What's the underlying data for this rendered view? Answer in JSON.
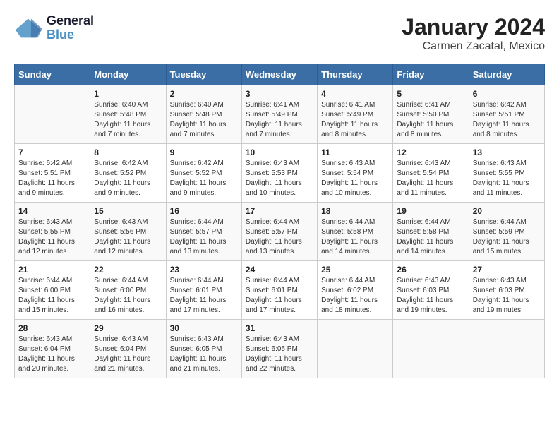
{
  "logo": {
    "line1": "General",
    "line2": "Blue"
  },
  "title": "January 2024",
  "subtitle": "Carmen Zacatal, Mexico",
  "days_of_week": [
    "Sunday",
    "Monday",
    "Tuesday",
    "Wednesday",
    "Thursday",
    "Friday",
    "Saturday"
  ],
  "weeks": [
    [
      {
        "day": "",
        "info": ""
      },
      {
        "day": "1",
        "info": "Sunrise: 6:40 AM\nSunset: 5:48 PM\nDaylight: 11 hours\nand 7 minutes."
      },
      {
        "day": "2",
        "info": "Sunrise: 6:40 AM\nSunset: 5:48 PM\nDaylight: 11 hours\nand 7 minutes."
      },
      {
        "day": "3",
        "info": "Sunrise: 6:41 AM\nSunset: 5:49 PM\nDaylight: 11 hours\nand 7 minutes."
      },
      {
        "day": "4",
        "info": "Sunrise: 6:41 AM\nSunset: 5:49 PM\nDaylight: 11 hours\nand 8 minutes."
      },
      {
        "day": "5",
        "info": "Sunrise: 6:41 AM\nSunset: 5:50 PM\nDaylight: 11 hours\nand 8 minutes."
      },
      {
        "day": "6",
        "info": "Sunrise: 6:42 AM\nSunset: 5:51 PM\nDaylight: 11 hours\nand 8 minutes."
      }
    ],
    [
      {
        "day": "7",
        "info": "Sunrise: 6:42 AM\nSunset: 5:51 PM\nDaylight: 11 hours\nand 9 minutes."
      },
      {
        "day": "8",
        "info": "Sunrise: 6:42 AM\nSunset: 5:52 PM\nDaylight: 11 hours\nand 9 minutes."
      },
      {
        "day": "9",
        "info": "Sunrise: 6:42 AM\nSunset: 5:52 PM\nDaylight: 11 hours\nand 9 minutes."
      },
      {
        "day": "10",
        "info": "Sunrise: 6:43 AM\nSunset: 5:53 PM\nDaylight: 11 hours\nand 10 minutes."
      },
      {
        "day": "11",
        "info": "Sunrise: 6:43 AM\nSunset: 5:54 PM\nDaylight: 11 hours\nand 10 minutes."
      },
      {
        "day": "12",
        "info": "Sunrise: 6:43 AM\nSunset: 5:54 PM\nDaylight: 11 hours\nand 11 minutes."
      },
      {
        "day": "13",
        "info": "Sunrise: 6:43 AM\nSunset: 5:55 PM\nDaylight: 11 hours\nand 11 minutes."
      }
    ],
    [
      {
        "day": "14",
        "info": "Sunrise: 6:43 AM\nSunset: 5:55 PM\nDaylight: 11 hours\nand 12 minutes."
      },
      {
        "day": "15",
        "info": "Sunrise: 6:43 AM\nSunset: 5:56 PM\nDaylight: 11 hours\nand 12 minutes."
      },
      {
        "day": "16",
        "info": "Sunrise: 6:44 AM\nSunset: 5:57 PM\nDaylight: 11 hours\nand 13 minutes."
      },
      {
        "day": "17",
        "info": "Sunrise: 6:44 AM\nSunset: 5:57 PM\nDaylight: 11 hours\nand 13 minutes."
      },
      {
        "day": "18",
        "info": "Sunrise: 6:44 AM\nSunset: 5:58 PM\nDaylight: 11 hours\nand 14 minutes."
      },
      {
        "day": "19",
        "info": "Sunrise: 6:44 AM\nSunset: 5:58 PM\nDaylight: 11 hours\nand 14 minutes."
      },
      {
        "day": "20",
        "info": "Sunrise: 6:44 AM\nSunset: 5:59 PM\nDaylight: 11 hours\nand 15 minutes."
      }
    ],
    [
      {
        "day": "21",
        "info": "Sunrise: 6:44 AM\nSunset: 6:00 PM\nDaylight: 11 hours\nand 15 minutes."
      },
      {
        "day": "22",
        "info": "Sunrise: 6:44 AM\nSunset: 6:00 PM\nDaylight: 11 hours\nand 16 minutes."
      },
      {
        "day": "23",
        "info": "Sunrise: 6:44 AM\nSunset: 6:01 PM\nDaylight: 11 hours\nand 17 minutes."
      },
      {
        "day": "24",
        "info": "Sunrise: 6:44 AM\nSunset: 6:01 PM\nDaylight: 11 hours\nand 17 minutes."
      },
      {
        "day": "25",
        "info": "Sunrise: 6:44 AM\nSunset: 6:02 PM\nDaylight: 11 hours\nand 18 minutes."
      },
      {
        "day": "26",
        "info": "Sunrise: 6:43 AM\nSunset: 6:03 PM\nDaylight: 11 hours\nand 19 minutes."
      },
      {
        "day": "27",
        "info": "Sunrise: 6:43 AM\nSunset: 6:03 PM\nDaylight: 11 hours\nand 19 minutes."
      }
    ],
    [
      {
        "day": "28",
        "info": "Sunrise: 6:43 AM\nSunset: 6:04 PM\nDaylight: 11 hours\nand 20 minutes."
      },
      {
        "day": "29",
        "info": "Sunrise: 6:43 AM\nSunset: 6:04 PM\nDaylight: 11 hours\nand 21 minutes."
      },
      {
        "day": "30",
        "info": "Sunrise: 6:43 AM\nSunset: 6:05 PM\nDaylight: 11 hours\nand 21 minutes."
      },
      {
        "day": "31",
        "info": "Sunrise: 6:43 AM\nSunset: 6:05 PM\nDaylight: 11 hours\nand 22 minutes."
      },
      {
        "day": "",
        "info": ""
      },
      {
        "day": "",
        "info": ""
      },
      {
        "day": "",
        "info": ""
      }
    ]
  ]
}
